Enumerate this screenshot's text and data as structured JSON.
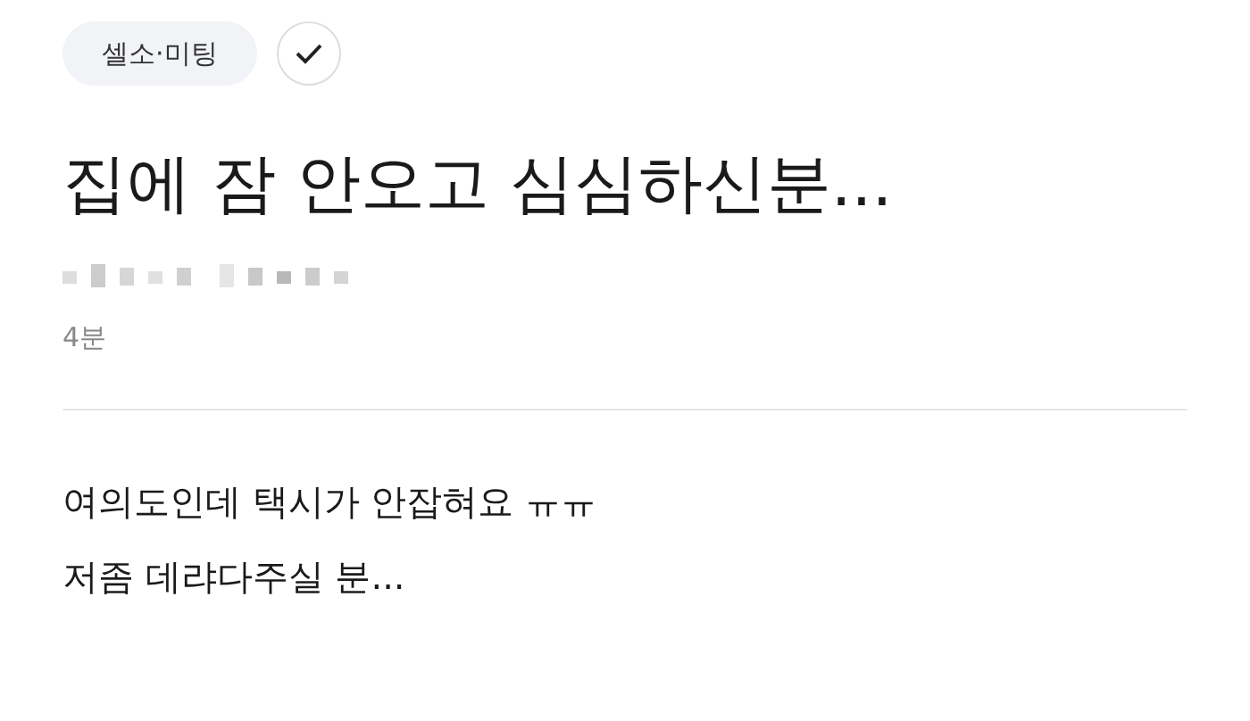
{
  "category": {
    "label": "셀소·미팅"
  },
  "title": "집에 잠 안오고 심심하신분...",
  "time": "4분",
  "body": [
    "여의도인데 택시가 안잡혀요 ㅠㅠ",
    "저좀 데랴다주실 분..."
  ]
}
